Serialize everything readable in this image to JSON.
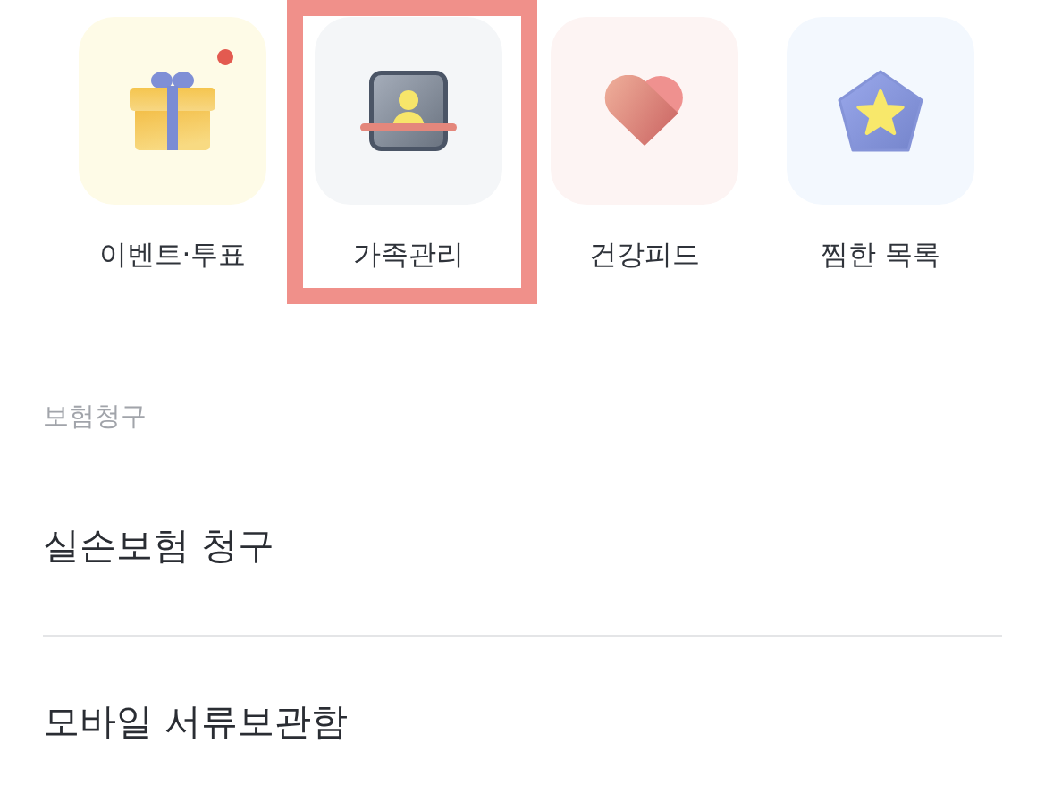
{
  "shortcuts": [
    {
      "kind": "gift",
      "label": "이벤트·투표",
      "badge": true,
      "highlighted": false
    },
    {
      "kind": "profile",
      "label": "가족관리",
      "badge": false,
      "highlighted": true
    },
    {
      "kind": "heart",
      "label": "건강피드",
      "badge": false,
      "highlighted": false
    },
    {
      "kind": "star",
      "label": "찜한 목록",
      "badge": false,
      "highlighted": false
    }
  ],
  "claims_section": {
    "title": "보험청구",
    "items": [
      {
        "label": "실손보험 청구"
      },
      {
        "label": "모바일 서류보관함"
      }
    ]
  }
}
